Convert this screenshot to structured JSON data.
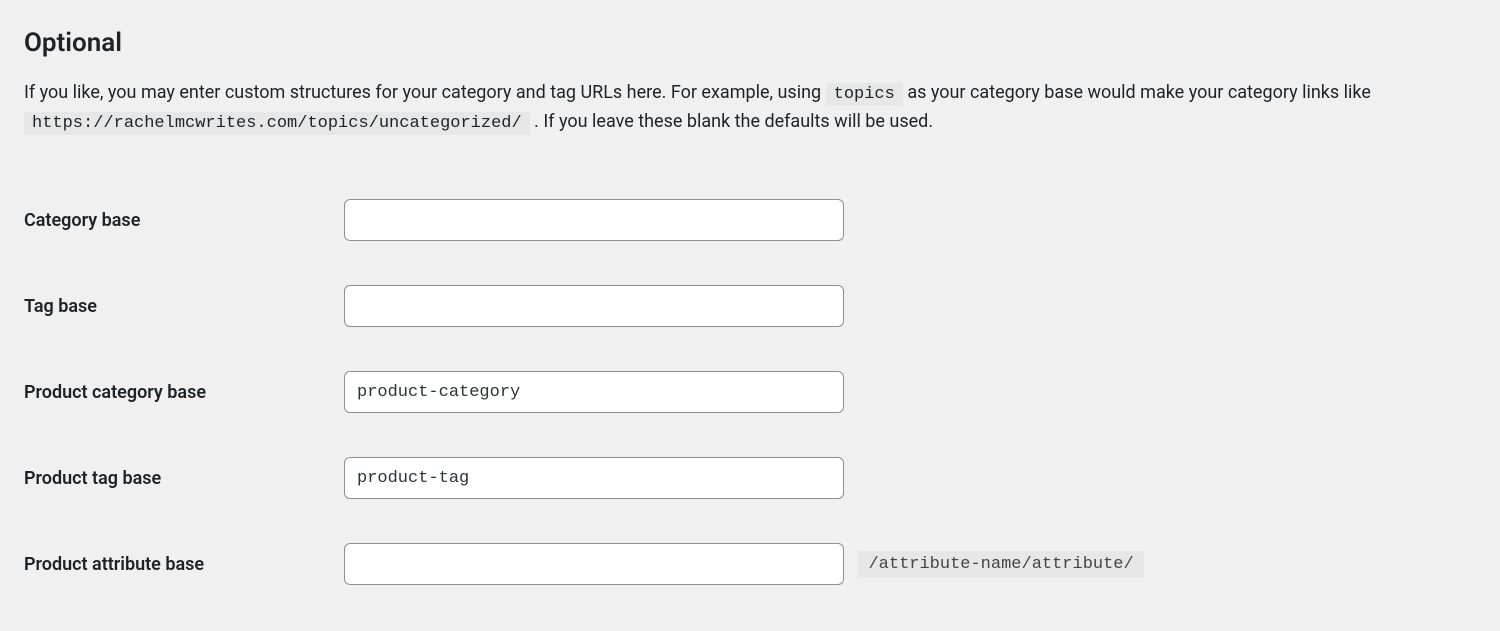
{
  "heading": "Optional",
  "description": {
    "part1": "If you like, you may enter custom structures for your category and tag URLs here. For example, using ",
    "code1": "topics",
    "part2": " as your category base would make your category links like ",
    "code2": "https://rachelmcwrites.com/topics/uncategorized/",
    "part3": " . If you leave these blank the defaults will be used."
  },
  "fields": {
    "category_base": {
      "label": "Category base",
      "value": ""
    },
    "tag_base": {
      "label": "Tag base",
      "value": ""
    },
    "product_category_base": {
      "label": "Product category base",
      "value": "product-category"
    },
    "product_tag_base": {
      "label": "Product tag base",
      "value": "product-tag"
    },
    "product_attribute_base": {
      "label": "Product attribute base",
      "value": "",
      "suffix": "/attribute-name/attribute/"
    }
  }
}
